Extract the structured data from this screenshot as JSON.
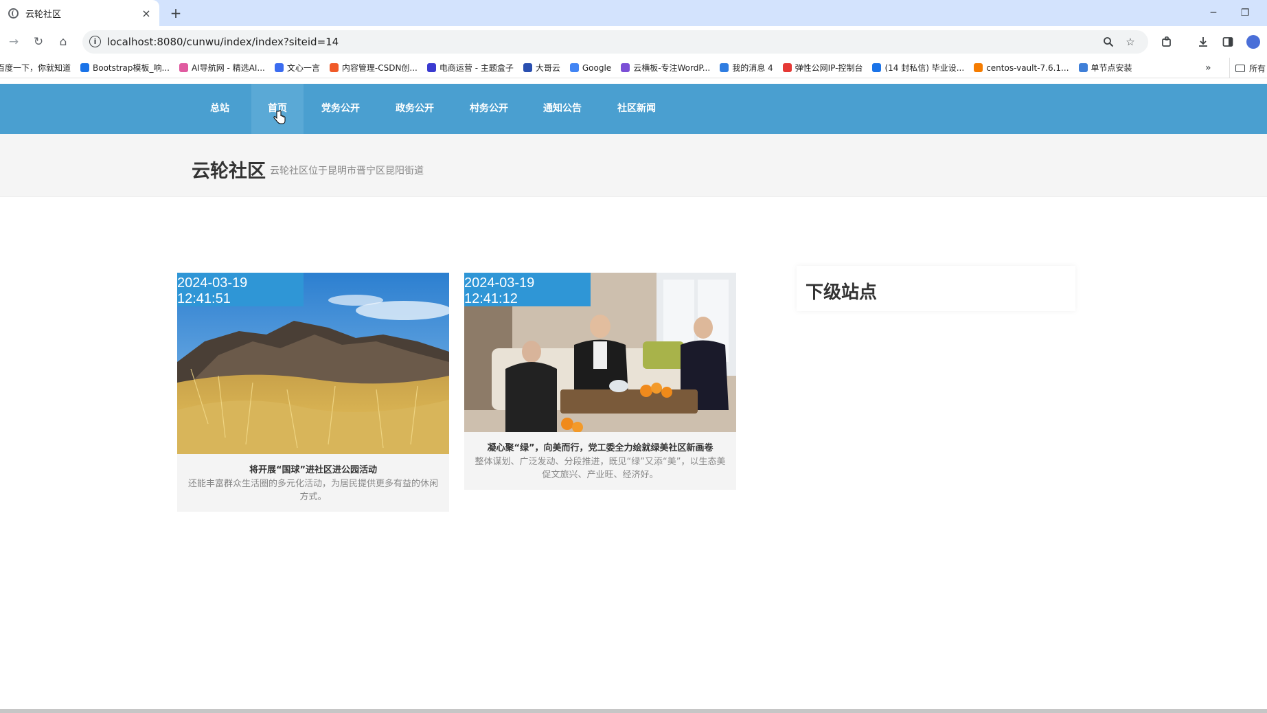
{
  "browser": {
    "tab_title": "云轮社区",
    "tab_close": "×",
    "new_tab": "+",
    "minimize": "─",
    "restore": "❐",
    "url": "localhost:8080/cunwu/index/index?siteid=14",
    "back": "→",
    "reload": "↻",
    "home": "⌂",
    "bookmarks": [
      {
        "label": "百度一下，你就知道",
        "icon_color": "#2d6ee0"
      },
      {
        "label": "Bootstrap模板_响...",
        "icon_color": "#1a73e8"
      },
      {
        "label": "AI导航网 - 精选AI...",
        "icon_color": "#e05ba0"
      },
      {
        "label": "文心一言",
        "icon_color": "#3b6cf0"
      },
      {
        "label": "内容管理-CSDN创...",
        "icon_color": "#f05a28"
      },
      {
        "label": "电商运营 - 主题盒子",
        "icon_color": "#3a3ad0"
      },
      {
        "label": "大哥云",
        "icon_color": "#2a4fb0"
      },
      {
        "label": "Google",
        "icon_color": "#4285f4"
      },
      {
        "label": "云横板-专注WordP...",
        "icon_color": "#7b4fd6"
      },
      {
        "label": "我的消息 4",
        "icon_color": "#2f7de1"
      },
      {
        "label": "弹性公网IP-控制台",
        "icon_color": "#e53935"
      },
      {
        "label": "(14 封私信) 毕业设...",
        "icon_color": "#1a73e8"
      },
      {
        "label": "centos-vault-7.6.1...",
        "icon_color": "#f57c00"
      },
      {
        "label": "单节点安装",
        "icon_color": "#3f7fd8"
      }
    ],
    "bookmarks_more": "»",
    "bookmarks_all": "所有"
  },
  "site": {
    "nav": [
      {
        "label": "总站"
      },
      {
        "label": "首页"
      },
      {
        "label": "党务公开"
      },
      {
        "label": "政务公开"
      },
      {
        "label": "村务公开"
      },
      {
        "label": "通知公告"
      },
      {
        "label": "社区新闻"
      }
    ],
    "active_nav": "首页",
    "hero_title": "云轮社区",
    "hero_subtitle": "云轮社区位于昆明市晋宁区昆阳街道",
    "articles": [
      {
        "date": "2024-03-19 12:41:51",
        "title": "将开展“国球”进社区进公园活动",
        "desc": "还能丰富群众生活圈的多元化活动，为居民提供更多有益的休闲方式。",
        "image": "dry grass on a rocky hillside under a blue sky"
      },
      {
        "date": "2024-03-19 12:41:12",
        "title": "凝心聚“绿”，向美而行，党工委全力绘就绿美社区新画卷",
        "desc": "整体谋划、广泛发动、分段推进，既见“绿”又添“美”，以生态美促文旅兴、产业旺、经济好。",
        "image": "officials talking on a sofa around a tea table with fruit"
      }
    ],
    "sidebar_title": "下级站点"
  },
  "colors": {
    "nav_bg": "#4a9fd0",
    "date_badge": "#2f96d6",
    "tabstrip": "#d3e3fd"
  }
}
